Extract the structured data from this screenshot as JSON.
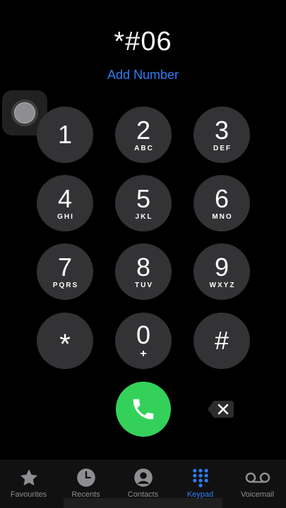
{
  "dialer": {
    "number": "*#06",
    "add_number": "Add Number"
  },
  "keypad": {
    "keys": [
      {
        "digit": "1",
        "letters": ""
      },
      {
        "digit": "2",
        "letters": "ABC"
      },
      {
        "digit": "3",
        "letters": "DEF"
      },
      {
        "digit": "4",
        "letters": "GHI"
      },
      {
        "digit": "5",
        "letters": "JKL"
      },
      {
        "digit": "6",
        "letters": "MNO"
      },
      {
        "digit": "7",
        "letters": "PQRS"
      },
      {
        "digit": "8",
        "letters": "TUV"
      },
      {
        "digit": "9",
        "letters": "WXYZ"
      },
      {
        "digit": "*",
        "letters": ""
      },
      {
        "digit": "0",
        "letters": "+"
      },
      {
        "digit": "#",
        "letters": ""
      }
    ]
  },
  "tabs": [
    {
      "label": "Favourites",
      "icon": "star-icon",
      "active": false
    },
    {
      "label": "Recents",
      "icon": "clock-icon",
      "active": false
    },
    {
      "label": "Contacts",
      "icon": "person-icon",
      "active": false
    },
    {
      "label": "Keypad",
      "icon": "keypad-icon",
      "active": true
    },
    {
      "label": "Voicemail",
      "icon": "voicemail-icon",
      "active": false
    }
  ],
  "colors": {
    "accent": "#2f7cf6",
    "call_green": "#34d15a",
    "key_bg": "#333335",
    "inactive_tab": "#8d8d92"
  }
}
